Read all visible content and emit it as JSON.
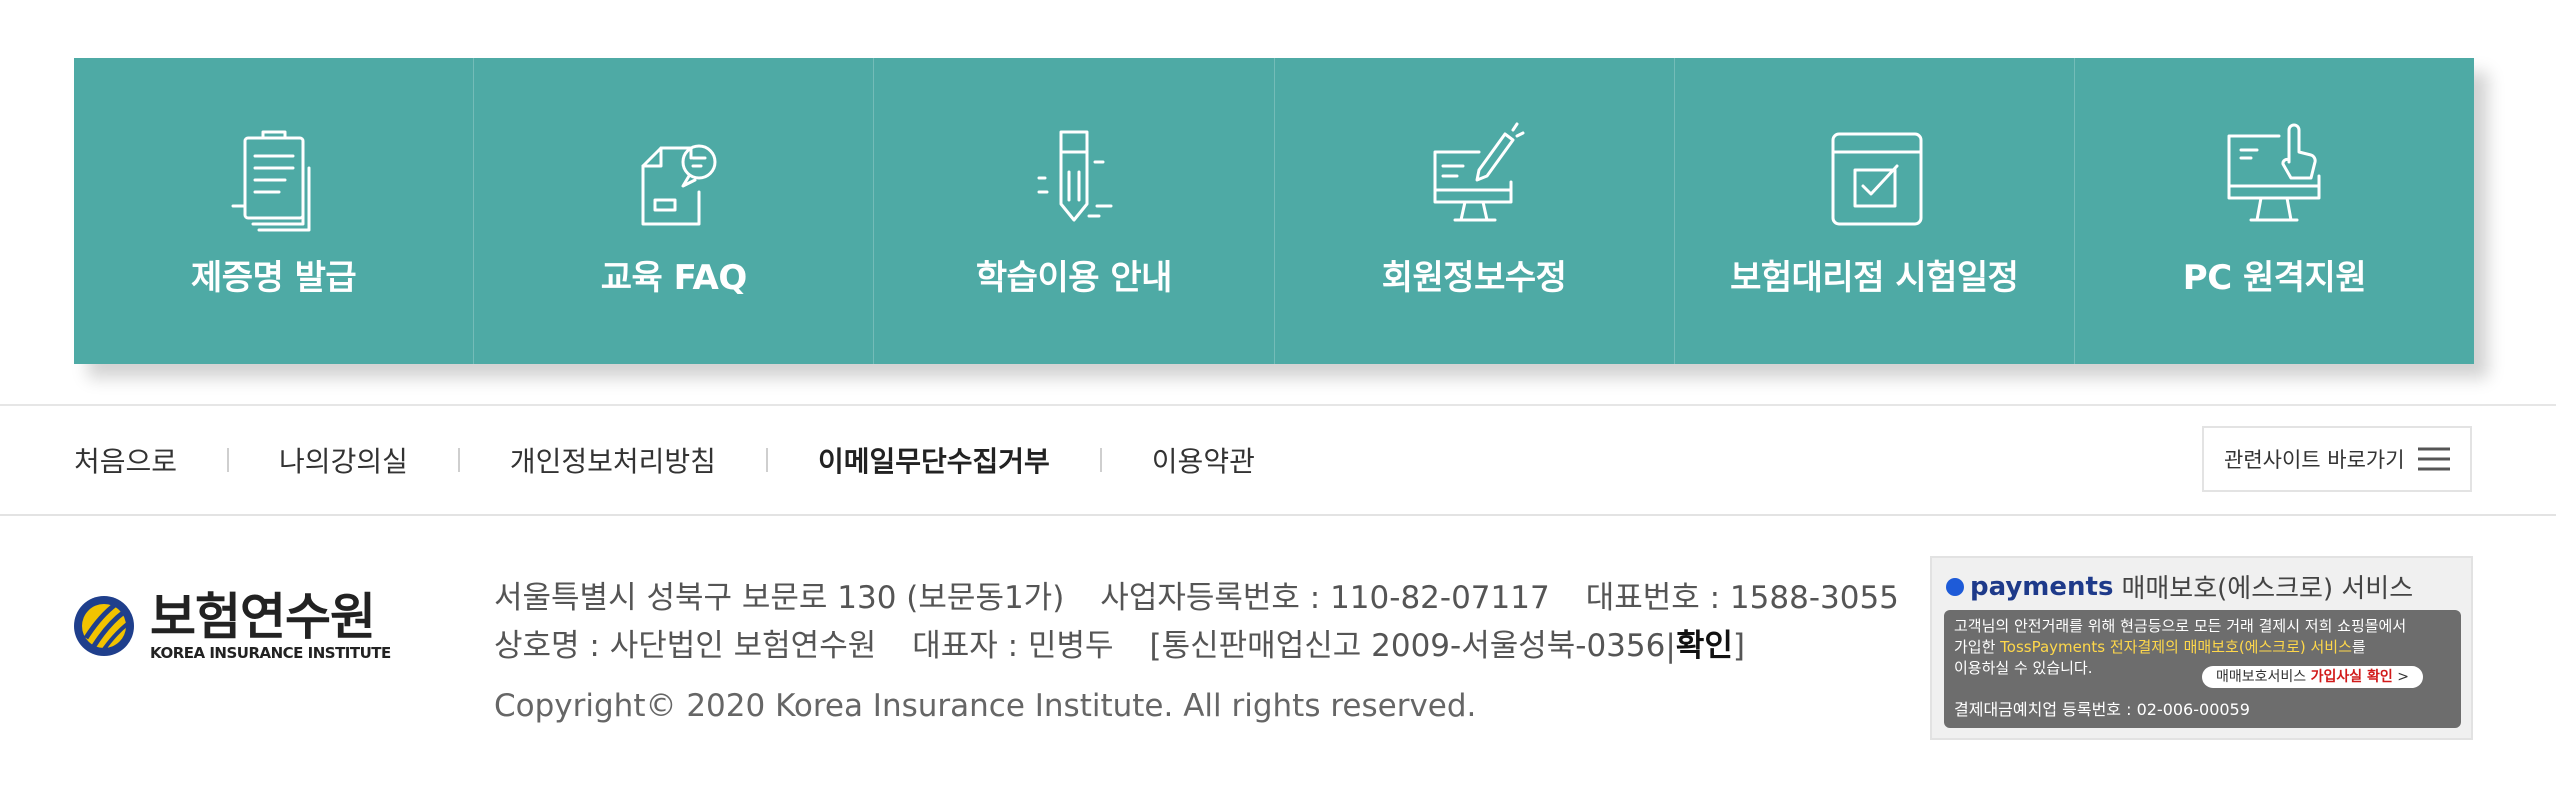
{
  "quick_menu": {
    "items": [
      {
        "label": "제증명 발급",
        "icon": "clipboard-certificate-icon"
      },
      {
        "label": "교육 FAQ",
        "icon": "document-chat-bubble-icon"
      },
      {
        "label": "학습이용 안내",
        "icon": "pen-nib-icon"
      },
      {
        "label": "회원정보수정",
        "icon": "monitor-edit-icon"
      },
      {
        "label": "보험대리점 시험일정",
        "icon": "calendar-check-icon"
      },
      {
        "label": "PC 원격지원",
        "icon": "monitor-hand-pointer-icon"
      }
    ],
    "color": "#4eaaa5"
  },
  "footer_nav": {
    "links": [
      "처음으로",
      "나의강의실",
      "개인정보처리방침",
      "이메일무단수집거부",
      "이용약관"
    ],
    "related_sites_label": "관련사이트 바로가기"
  },
  "logo": {
    "korean": "보험연수원",
    "english": "KOREA INSURANCE INSTITUTE"
  },
  "company_info": {
    "address": "서울특별시 성북구 보문로 130 (보문동1가)",
    "business_reg": "사업자등록번호 : 110-82-07117",
    "phone": "대표번호 : 1588-3055",
    "company_name": "상호명 : 사단법인 보험연수원",
    "ceo": "대표자 : 민병두",
    "ecommerce_prefix": "[통신판매업신고 2009-서울성북-0356|",
    "ecommerce_verify": "확인",
    "ecommerce_suffix": "]",
    "copyright": "Copyright© 2020 Korea Insurance Institute. All rights reserved."
  },
  "escrow": {
    "brand": "payments",
    "title": "매매보호(에스크로) 서비스",
    "desc_line1": "고객님의 안전거래를 위해 현금등으로 모든 거래 결제시 저희 쇼핑몰에서",
    "desc_line2_prefix": "가입한 ",
    "desc_line2_highlight": "TossPayments 전자결제의 매매보호(에스크로) 서비스",
    "desc_line2_suffix": "를",
    "desc_line3": "이용하실 수 있습니다.",
    "check_prefix": "매매보호서비스 ",
    "check_highlight": "가입사실 확인",
    "check_suffix": " >",
    "registration": "결제대금예치업 등록번호 : 02-006-00059"
  }
}
